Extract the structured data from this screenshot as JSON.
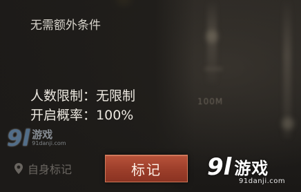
{
  "panel": {
    "condition": "无需额外条件",
    "player_limit": {
      "label": "人数限制：",
      "value": "无限制"
    },
    "probability": {
      "label": "开启概率：",
      "value": "100%"
    }
  },
  "map": {
    "scale_label": "100M"
  },
  "actions": {
    "self_mark_label": "自身标记",
    "self_mark_icon": "map-pin-icon",
    "mark_button_label": "标记",
    "mark_button_color": "#a8472f"
  },
  "watermarks": {
    "small": {
      "logo": "9l",
      "brand": "游戏",
      "domain": "91danji.com"
    },
    "large": {
      "logo": "9l",
      "brand": "游戏",
      "domain": "91danji.com"
    }
  }
}
